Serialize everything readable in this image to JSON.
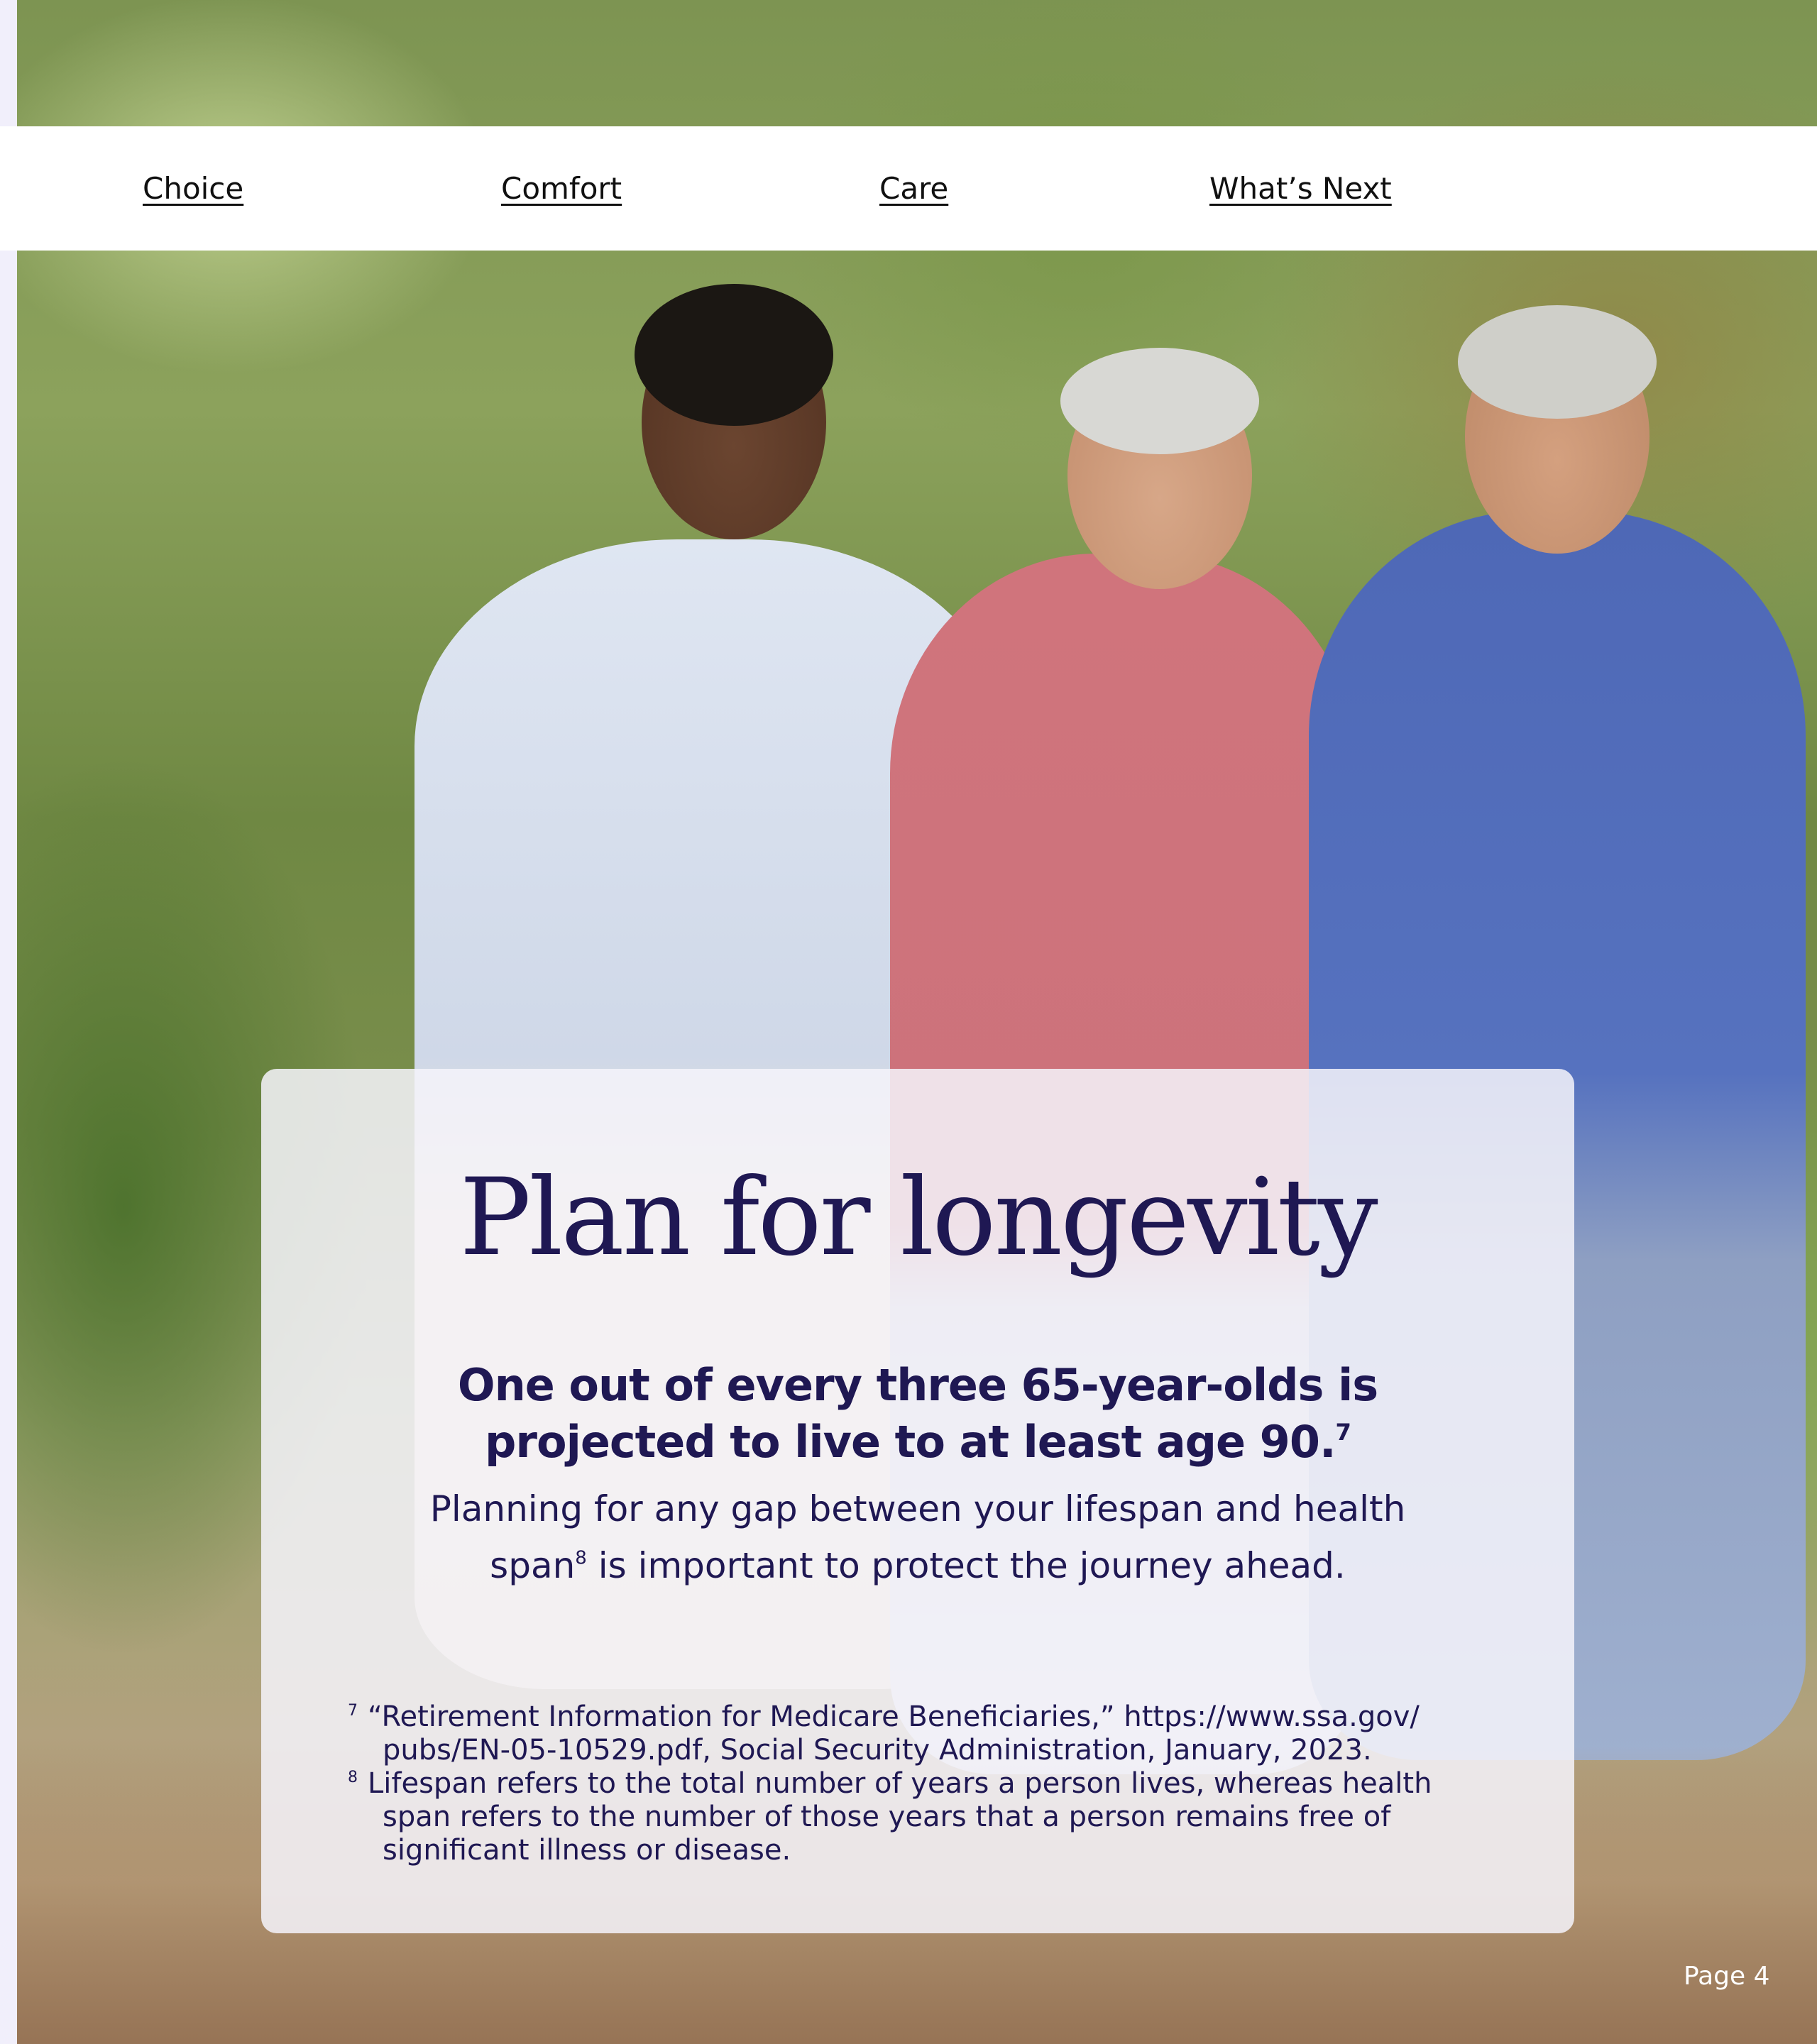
{
  "nav": {
    "items": [
      {
        "label": "Choice"
      },
      {
        "label": "Comfort"
      },
      {
        "label": "Care"
      },
      {
        "label": "What’s Next"
      }
    ]
  },
  "hero": {
    "image_description_icon": "photo-three-women-walking"
  },
  "card": {
    "title": "Plan for longevity",
    "stat_line_1": "One out of every three 65-year-olds is",
    "stat_line_2": "projected to live to at least age 90.",
    "stat_ref": "7",
    "body_line_1": "Planning for any gap between your lifespan and health",
    "body_line_2_a": "span",
    "body_ref": "8",
    "body_line_2_b": " is important to protect the journey ahead.",
    "footnotes": [
      {
        "number": "7",
        "lines": [
          "“Retirement Information for Medicare Beneficiaries,” https://www.ssa.gov/",
          "pubs/EN-05-10529.pdf, Social Security Administration, January, 2023."
        ]
      },
      {
        "number": "8",
        "lines": [
          "Lifespan refers to the total number of years a person lives, whereas health",
          "span refers to the number of those years that a person remains free of",
          "significant illness or disease."
        ]
      }
    ]
  },
  "footer": {
    "page_number": "Page 4"
  },
  "colors": {
    "headline": "#1f1853",
    "card_background": "#f4f3fa",
    "nav_background": "#ffffff",
    "page_edge": "#f1effb"
  }
}
